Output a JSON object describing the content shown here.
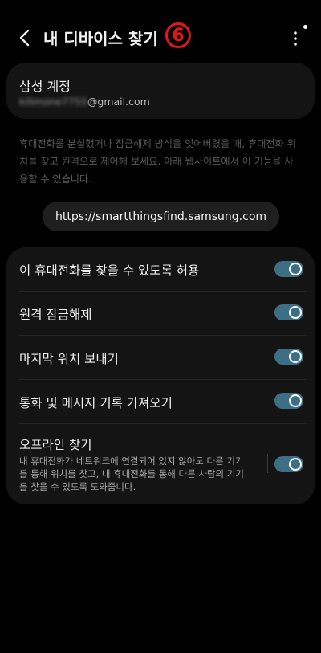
{
  "header": {
    "title": "내 디바이스 찾기",
    "badge": "6"
  },
  "account": {
    "title": "삼성 계정",
    "email_hidden": "kilimone7755",
    "email_domain": "@gmail.com"
  },
  "description": "휴대전화를 분실했거나 잠금해제 방식을 잊어버렸을 때, 휴대전화 위치를 찾고 원격으로 제어해 보세요. 아래 웹사이트에서 이 기능을 사용할 수 있습니다.",
  "url": "https://smartthingsfind.samsung.com",
  "settings": {
    "items": [
      {
        "label": "이 휴대전화를 찾을 수 있도록 허용",
        "on": true
      },
      {
        "label": "원격 잠금해제",
        "on": true
      },
      {
        "label": "마지막 위치 보내기",
        "on": true
      },
      {
        "label": "통화 및 메시지 기록 가져오기",
        "on": true
      },
      {
        "label": "오프라인 찾기",
        "sub": "내 휴대전화가 네트워크에 연결되어 있지 않아도 다른 기기를 통해 위치를 찾고, 내 휴대전화를 통해 다른 사람의 기기를 찾을 수 있도록 도와줍니다.",
        "on": true
      }
    ]
  },
  "colors": {
    "background": "#000000",
    "card": "#141414",
    "toggle_on": "#3c6e86",
    "badge": "#e4161d"
  }
}
